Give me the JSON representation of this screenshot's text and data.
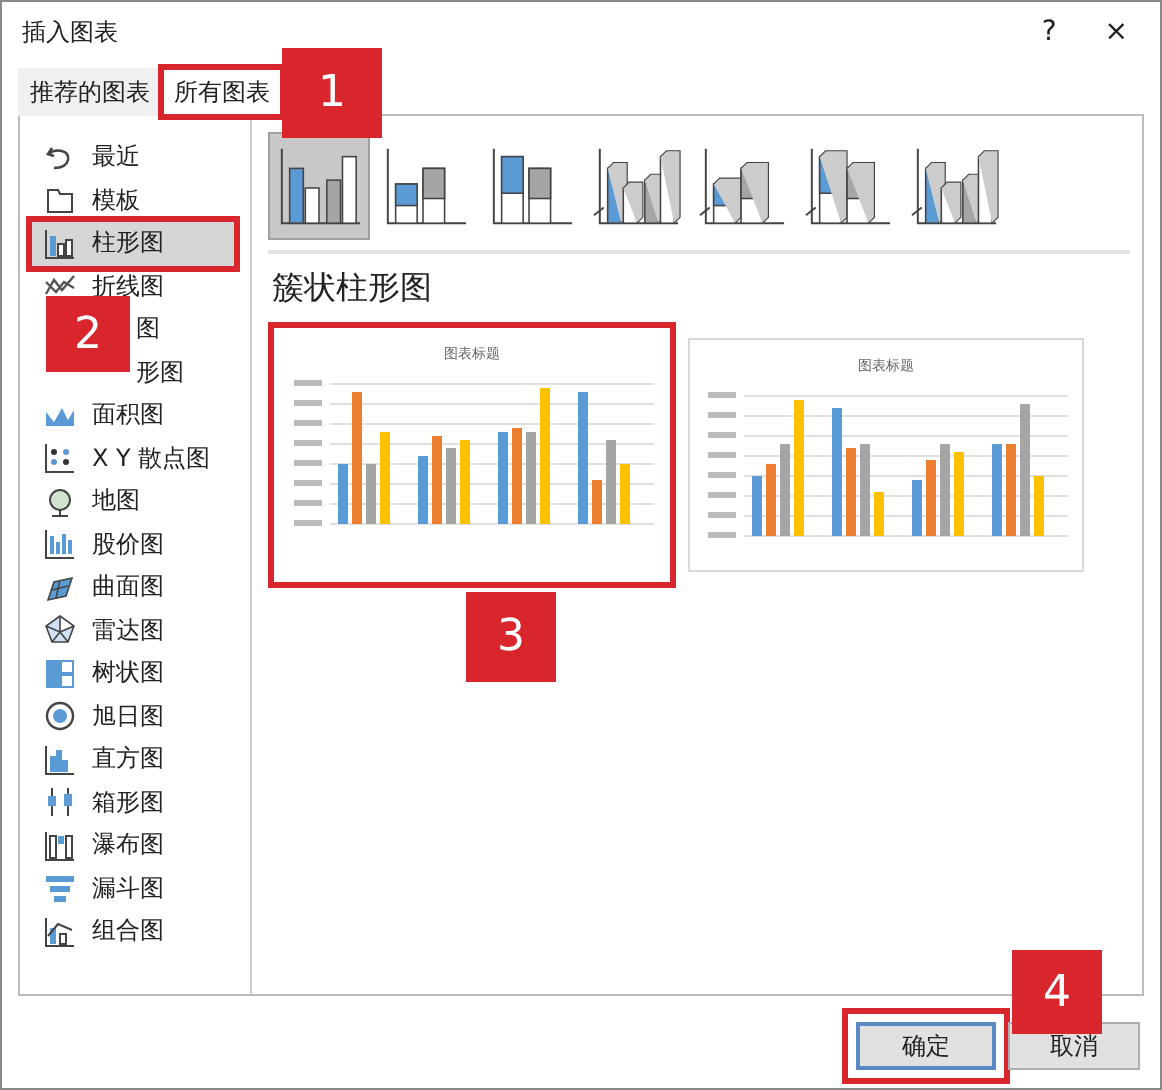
{
  "window": {
    "title": "插入图表",
    "help": "?",
    "close": "×"
  },
  "tabs": [
    {
      "label": "推荐的图表",
      "selected": false,
      "highlighted": false
    },
    {
      "label": "所有图表",
      "selected": true,
      "highlighted": true
    }
  ],
  "sidebar": {
    "items": [
      {
        "label": "最近",
        "selected": false,
        "highlighted": false,
        "covered": false
      },
      {
        "label": "模板",
        "selected": false,
        "highlighted": false,
        "covered": false
      },
      {
        "label": "柱形图",
        "selected": true,
        "highlighted": true,
        "covered": false
      },
      {
        "label": "折线图",
        "selected": false,
        "highlighted": false,
        "covered": false
      },
      {
        "label": "图",
        "selected": false,
        "highlighted": false,
        "covered": true
      },
      {
        "label": "形图",
        "selected": false,
        "highlighted": false,
        "covered": true
      },
      {
        "label": "面积图",
        "selected": false,
        "highlighted": false,
        "covered": false
      },
      {
        "label": "X Y 散点图",
        "selected": false,
        "highlighted": false,
        "covered": false
      },
      {
        "label": "地图",
        "selected": false,
        "highlighted": false,
        "covered": false
      },
      {
        "label": "股价图",
        "selected": false,
        "highlighted": false,
        "covered": false
      },
      {
        "label": "曲面图",
        "selected": false,
        "highlighted": false,
        "covered": false
      },
      {
        "label": "雷达图",
        "selected": false,
        "highlighted": false,
        "covered": false
      },
      {
        "label": "树状图",
        "selected": false,
        "highlighted": false,
        "covered": false
      },
      {
        "label": "旭日图",
        "selected": false,
        "highlighted": false,
        "covered": false
      },
      {
        "label": "直方图",
        "selected": false,
        "highlighted": false,
        "covered": false
      },
      {
        "label": "箱形图",
        "selected": false,
        "highlighted": false,
        "covered": false
      },
      {
        "label": "瀑布图",
        "selected": false,
        "highlighted": false,
        "covered": false
      },
      {
        "label": "漏斗图",
        "selected": false,
        "highlighted": false,
        "covered": false
      },
      {
        "label": "组合图",
        "selected": false,
        "highlighted": false,
        "covered": false
      }
    ]
  },
  "chart_subtypes": [
    {
      "selected": true
    },
    {
      "selected": false
    },
    {
      "selected": false
    },
    {
      "selected": false
    },
    {
      "selected": false
    },
    {
      "selected": false
    },
    {
      "selected": false
    }
  ],
  "heading": "簇状柱形图",
  "previews": [
    {
      "title": "图表标题",
      "selected": true,
      "highlighted": true
    },
    {
      "title": "图表标题",
      "selected": false,
      "highlighted": false
    }
  ],
  "buttons": [
    {
      "label": "确定",
      "default": true,
      "highlighted": true
    },
    {
      "label": "取消",
      "default": false,
      "highlighted": false
    }
  ],
  "callouts": [
    {
      "label": "1"
    },
    {
      "label": "2"
    },
    {
      "label": "3"
    },
    {
      "label": "4"
    }
  ]
}
